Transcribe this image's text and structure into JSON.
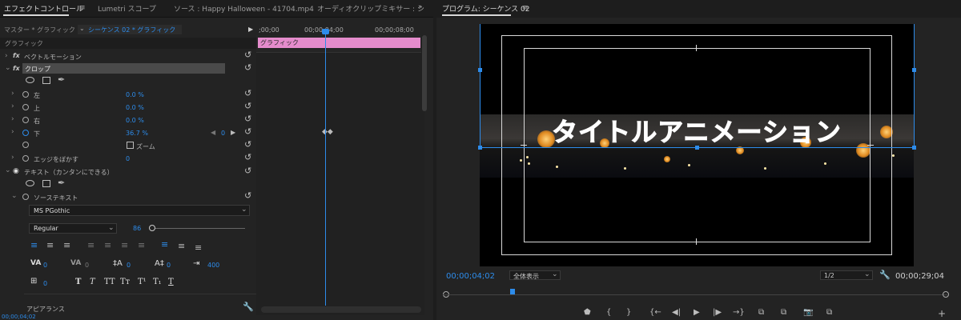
{
  "left_tabs": [
    "エフェクトコントロール",
    "Lumetri スコープ",
    "ソース : Happy Halloween - 41704.mp4",
    "オーディオクリップミキサー : シ"
  ],
  "left_menu_icon": "hamburger-icon",
  "master_label": "マスター * グラフィック",
  "sequence_label": "シーケンス 02 * グラフィック",
  "section_label": "グラフィック",
  "effects": {
    "motion": "ベクトルモーション",
    "crop": "クロップ",
    "crop_params": [
      {
        "label": "左",
        "value": "0.0 %"
      },
      {
        "label": "上",
        "value": "0.0 %"
      },
      {
        "label": "右",
        "value": "0.0 %"
      },
      {
        "label": "下",
        "value": "36.7 %"
      }
    ],
    "zoom_label": "ズーム",
    "feather_label": "エッジをぼかす",
    "feather_value": "0",
    "kf_value": "0"
  },
  "text_layer": {
    "name": "テキスト（カンタンにできる）",
    "source_text": "ソーステキスト",
    "font": "MS PGothic",
    "style": "Regular",
    "size": "86",
    "tracking": "0",
    "kerning": "0",
    "leading": "0",
    "baseline": "0",
    "tsume": "400",
    "tab_width": "0",
    "type_buttons": [
      "T",
      "T",
      "TT",
      "Tт",
      "T¹",
      "T₁",
      "T"
    ]
  },
  "appearance_label": "アピアランス",
  "timeline": {
    "ruler_labels": [
      ";00;00",
      "00;00;04;00",
      "00;00;08;00"
    ],
    "clip_label": "グラフィック",
    "bottom_timecode": "00;00;04;02"
  },
  "program": {
    "tab_label": "プログラム: シーケンス 02",
    "title_text": "タイトルアニメーション",
    "timecode_current": "00;00;04;02",
    "zoom_option": "全体表示",
    "resolution_option": "1/2",
    "timecode_duration": "00;00;29;04"
  },
  "colors": {
    "accent": "#2d8ceb",
    "clip_pink": "#e58ccc"
  }
}
